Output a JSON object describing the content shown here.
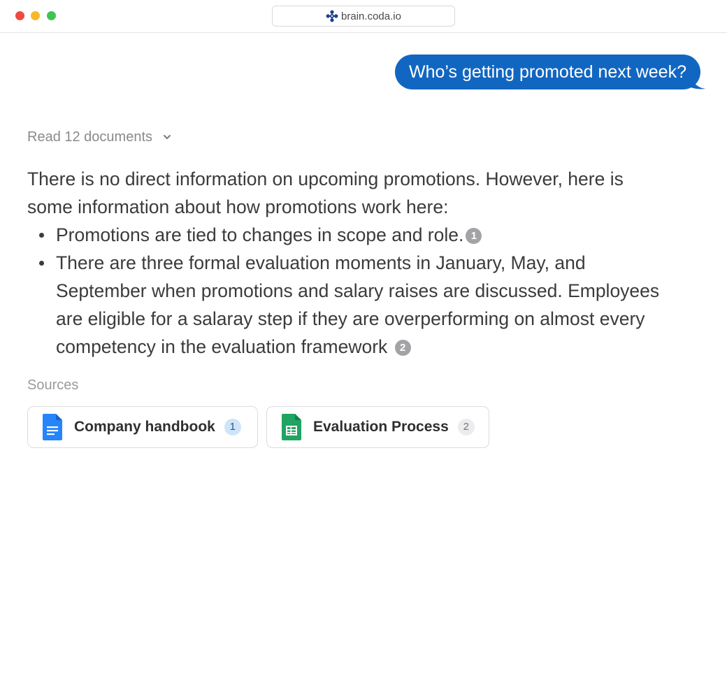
{
  "window": {
    "controls": {
      "close_color": "#ee4b40",
      "minimize_color": "#f6b92c",
      "zoom_color": "#3fc453"
    },
    "url": "brain.coda.io",
    "url_icon": "coda-brain-logo-icon"
  },
  "conversation": {
    "user_message": "Who’s getting promoted next week?",
    "bubble_color": "#1166c1",
    "read_documents": "Read 12 documents",
    "answer": {
      "intro": "There is no direct information on upcoming promotions. However, here is some information about how promotions work here:",
      "bullets": [
        {
          "text": "Promotions are tied to changes in scope and role.",
          "citation": "1"
        },
        {
          "text": "There are three formal evaluation moments in January, May, and September when promotions and salary raises are discussed. Employees are eligible for a salaray step if they are overperforming on almost every competency in the evaluation framework",
          "citation": "2"
        }
      ]
    },
    "sources": {
      "label": "Sources",
      "items": [
        {
          "name": "Company handbook",
          "number": "1",
          "icon": "google-docs-icon",
          "icon_color": "#2684fc"
        },
        {
          "name": "Evaluation Process",
          "number": "2",
          "icon": "google-sheets-icon",
          "icon_color": "#1fa463"
        }
      ]
    }
  }
}
